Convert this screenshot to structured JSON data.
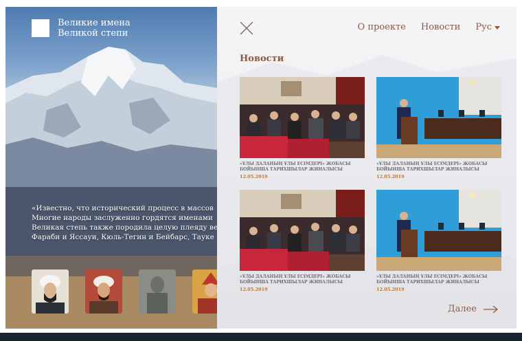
{
  "site": {
    "logo_line1": "Великие имена",
    "logo_line2": "Великой степи"
  },
  "hero": {
    "quote_lines": [
      "«Известно, что исторический процесс в массов",
      "Многие народы заслуженно гордятся именами",
      "Великая степь также породила целую плеяду ве",
      "Фараби и Яссауи, Кюль-Тегин и Бейбарс, Тауке и"
    ],
    "portraits": [
      "portrait-1",
      "portrait-2",
      "portrait-3",
      "portrait-4"
    ]
  },
  "nav": {
    "about": "О проекте",
    "news": "Новости",
    "lang": "Рус"
  },
  "news": {
    "title": "Новости",
    "cards": [
      {
        "caption": "«ҰЛЫ ДАЛАНЫҢ ҰЛЫ ЕСІМДЕРІ» ЖОБАСЫ БОЙЫНША ТАРИХШЫЛАР ЖИНАЛЫСЫ",
        "date": "12.05.2019",
        "photo": "auditorium"
      },
      {
        "caption": "«ҰЛЫ ДАЛАНЫҢ ҰЛЫ ЕСІМДЕРІ» ЖОБАСЫ БОЙЫНША ТАРИХШЫЛАР ЖИНАЛЫСЫ",
        "date": "12.05.2019",
        "photo": "podium"
      },
      {
        "caption": "«ҰЛЫ ДАЛАНЫҢ ҰЛЫ ЕСІМДЕРІ» ЖОБАСЫ БОЙЫНША ТАРИХШЫЛАР ЖИНАЛЫСЫ",
        "date": "12.05.2019",
        "photo": "auditorium"
      },
      {
        "caption": "«ҰЛЫ ДАЛАНЫҢ ҰЛЫ ЕСІМДЕРІ» ЖОБАСЫ БОЙЫНША ТАРИХШЫЛАР ЖИНАЛЫСЫ",
        "date": "12.05.2019",
        "photo": "podium"
      }
    ],
    "more_label": "Далее"
  },
  "colors": {
    "accent": "#8a5a45",
    "date": "#b07a3f",
    "panel_bg": "#f1f1f4"
  }
}
